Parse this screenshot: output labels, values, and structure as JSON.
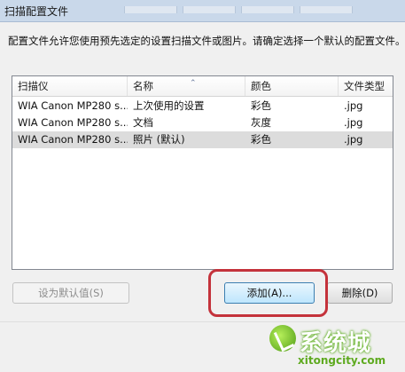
{
  "window": {
    "title": "扫描配置文件"
  },
  "description": "配置文件允许您使用预先选定的设置扫描文件或图片。请确定选择一个默认的配置文件。",
  "list": {
    "columns": [
      "扫描仪",
      "名称",
      "颜色",
      "文件类型"
    ],
    "rows": [
      {
        "scanner": "WIA Canon MP280 s...",
        "name": "上次使用的设置",
        "color": "彩色",
        "filetype": ".jpg",
        "selected": false
      },
      {
        "scanner": "WIA Canon MP280 s...",
        "name": "文档",
        "color": "灰度",
        "filetype": ".jpg",
        "selected": false
      },
      {
        "scanner": "WIA Canon MP280 s...",
        "name": "照片 (默认)",
        "color": "彩色",
        "filetype": ".jpg",
        "selected": true
      }
    ]
  },
  "buttons": {
    "set_default": "设为默认值(S)",
    "add": "添加(A)...",
    "delete": "删除(D)"
  },
  "watermark": {
    "cn": "系统城",
    "en": "xitongcity.com"
  },
  "colors": {
    "highlight": "#c4323b",
    "titlebar": "#c9d8ea",
    "selected_row": "#dcdcdc"
  },
  "icons": {
    "sort": "sort-ascending-icon"
  }
}
